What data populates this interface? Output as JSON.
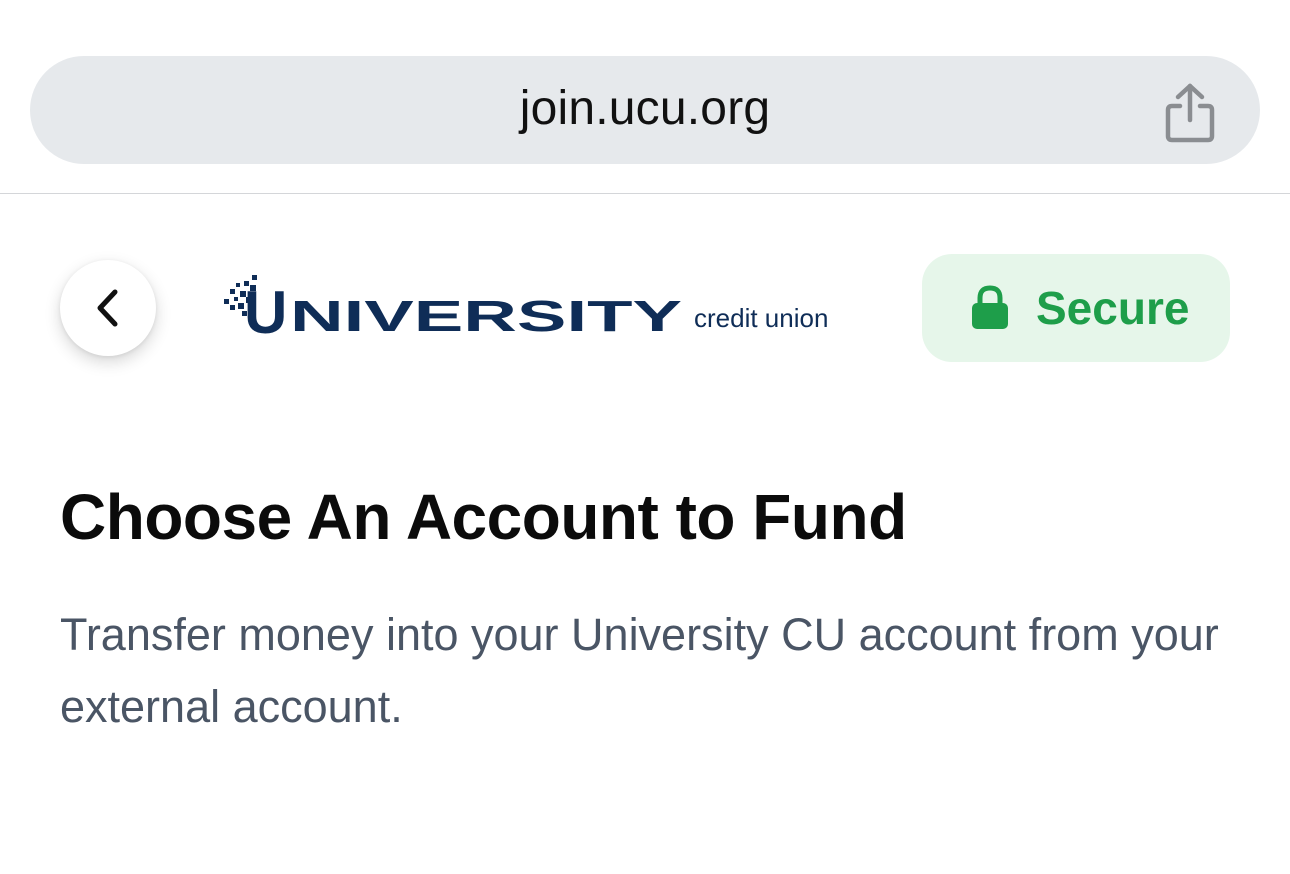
{
  "browser": {
    "url": "join.ucu.org",
    "share_icon": "share-icon"
  },
  "header": {
    "back_icon": "chevron-left-icon",
    "logo": {
      "wordmark": "UNIVERSITY",
      "tagline": "credit union",
      "brand_color": "#0f2d57"
    },
    "secure_badge": {
      "label": "Secure",
      "icon": "lock-icon",
      "color": "#1e9e4a",
      "background": "#e6f6ea"
    }
  },
  "main": {
    "title": "Choose An Account to Fund",
    "description": "Transfer money into your University CU account from your external account."
  }
}
